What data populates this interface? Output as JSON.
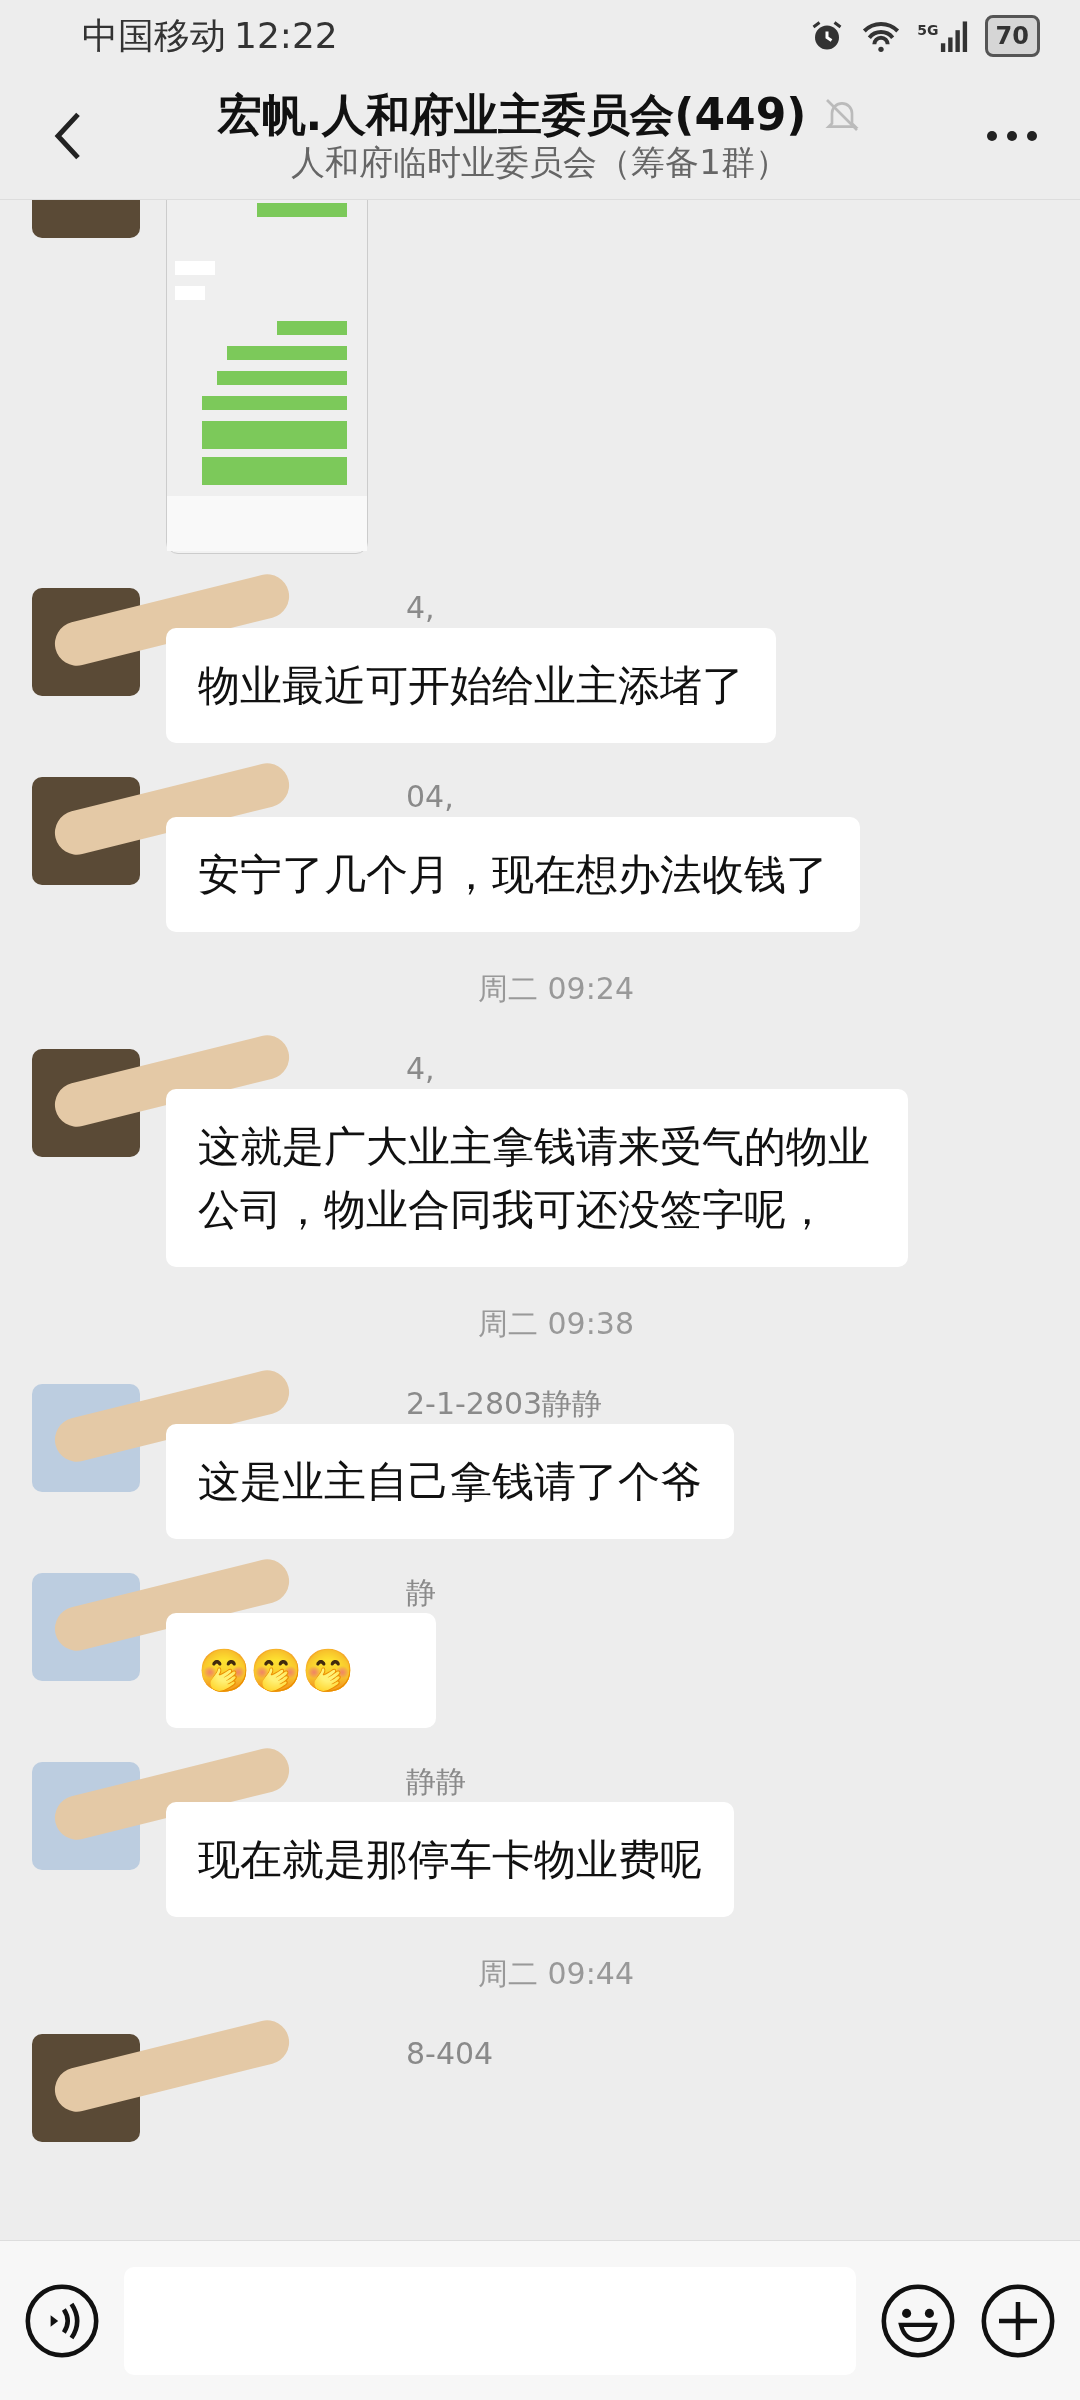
{
  "status_bar": {
    "carrier": "中国移动",
    "time": "12:22",
    "network": "5G",
    "battery": "70"
  },
  "header": {
    "title": "宏帆.人和府业主委员会(449)",
    "subtitle": "人和府临时业委员会（筹备1群）",
    "muted": true
  },
  "messages": [
    {
      "kind": "image",
      "color": "#5a4a36"
    },
    {
      "kind": "text",
      "color": "#5a4a36",
      "sender": "4,",
      "text": "物业最近可开始给业主添堵了"
    },
    {
      "kind": "text",
      "color": "#5a4a36",
      "sender": "04,",
      "text": "安宁了几个月，现在想办法收钱了"
    },
    {
      "kind": "time",
      "text": "周二 09:24"
    },
    {
      "kind": "text",
      "color": "#5a4a36",
      "sender": "4,",
      "text": "这就是广大业主拿钱请来受气的物业公司，物业合同我可还没签字呢，"
    },
    {
      "kind": "time",
      "text": "周二 09:38"
    },
    {
      "kind": "text",
      "color": "#bccde0",
      "sender": "2-1-2803静静",
      "text": "这是业主自己拿钱请了个爷"
    },
    {
      "kind": "text",
      "color": "#bccde0",
      "sender": "静",
      "text": "🤭🤭🤭"
    },
    {
      "kind": "text",
      "color": "#bccde0",
      "sender": "静静",
      "text": "现在就是那停车卡物业费呢"
    },
    {
      "kind": "time",
      "text": "周二 09:44"
    },
    {
      "kind": "text",
      "color": "#5a4a36",
      "sender": "8-404"
    }
  ],
  "input_bar": {
    "voice": true
  }
}
